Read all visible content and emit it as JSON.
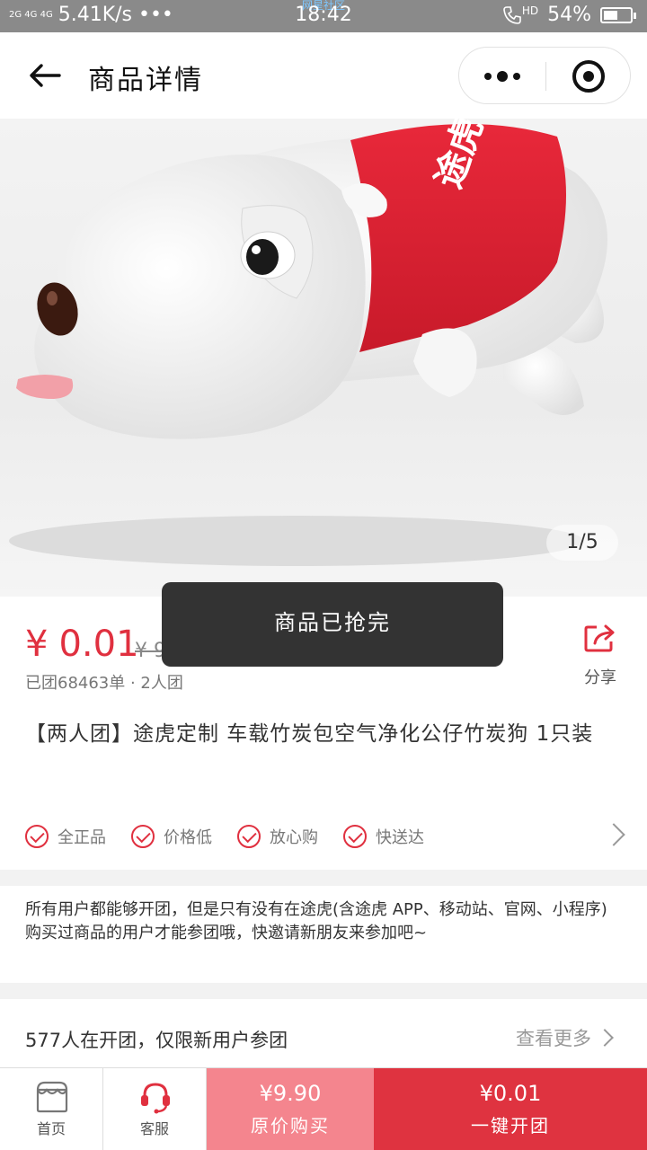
{
  "status_bar": {
    "network": "2G 4G 4G",
    "speed": "5.41K/s •••",
    "carrier_label": "网星社区",
    "time": "18:42",
    "hd": "HD",
    "battery": "54%",
    "battery_level": 0.54
  },
  "header": {
    "title": "商品详情"
  },
  "gallery": {
    "counter": "1/5",
    "shirt_text": "途虎"
  },
  "toast": {
    "message": "商品已抢完"
  },
  "product": {
    "currency": "¥",
    "price": "0.01",
    "original_price": "¥ 9.90",
    "sold_info": "已团68463单 · 2人团",
    "share_label": "分享",
    "title": "【两人团】途虎定制 车载竹炭包空气净化公仔竹炭狗 1只装"
  },
  "guarantees": [
    {
      "label": "全正品"
    },
    {
      "label": "价格低"
    },
    {
      "label": "放心购"
    },
    {
      "label": "快送达"
    }
  ],
  "notice": {
    "text": "所有用户都能够开团，但是只有没有在途虎(含途虎 APP、移动站、官网、小程序)购买过商品的用户才能参团哦，快邀请新朋友来参加吧~"
  },
  "group_row": {
    "text": "577人在开团，仅限新用户参团",
    "more": "查看更多"
  },
  "bottom_bar": {
    "home_label": "首页",
    "service_label": "客服",
    "orig_buy_price": "¥9.90",
    "orig_buy_label": "原价购买",
    "group_buy_price": "¥0.01",
    "group_buy_label": "一键开团"
  },
  "colors": {
    "accent": "#e0303f",
    "orig_button": "#f4858e",
    "group_button": "#df3340"
  }
}
